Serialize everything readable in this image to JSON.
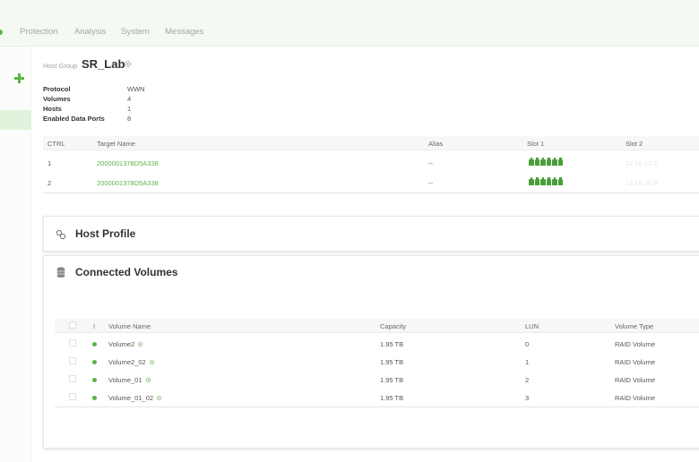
{
  "nav": {
    "items": [
      "Protection",
      "Analysis",
      "System",
      "Messages"
    ]
  },
  "host_group": {
    "label": "Host Group",
    "name": "SR_Lab",
    "properties": [
      {
        "label": "Protocol",
        "value": "WWN"
      },
      {
        "label": "Volumes",
        "value": "4"
      },
      {
        "label": "Hosts",
        "value": "1"
      },
      {
        "label": "Enabled Data Ports",
        "value": "8"
      }
    ]
  },
  "ports_table": {
    "columns": [
      "CTRL",
      "Target Name",
      "Alias",
      "Slot 1",
      "Slot 2"
    ],
    "rows": [
      {
        "ctrl": "1",
        "target": "2000001378D5A338",
        "alias": "--",
        "slot2": "12.16.10 2"
      },
      {
        "ctrl": "2",
        "target": "2000001378D5A338",
        "alias": "--",
        "slot2": "12.16.10 3"
      }
    ]
  },
  "panels": {
    "host_profile": "Host Profile",
    "connected_volumes": "Connected Volumes"
  },
  "volumes_table": {
    "columns": [
      "!",
      "Volume Name",
      "Capacity",
      "LUN",
      "Volume Type"
    ],
    "rows": [
      {
        "name": "Volume2",
        "capacity": "1.95 TB",
        "lun": "0",
        "type": "RAID Volume"
      },
      {
        "name": "Volume2_02",
        "capacity": "1.95 TB",
        "lun": "1",
        "type": "RAID Volume"
      },
      {
        "name": "Volume_01",
        "capacity": "1.95 TB",
        "lun": "2",
        "type": "RAID Volume"
      },
      {
        "name": "Volume_01_02",
        "capacity": "1.95 TB",
        "lun": "3",
        "type": "RAID Volume"
      }
    ]
  },
  "colors": {
    "accent": "#5bb544",
    "slot_icon": "#4a9e3a",
    "topbar_bg": "#f4faf1"
  }
}
